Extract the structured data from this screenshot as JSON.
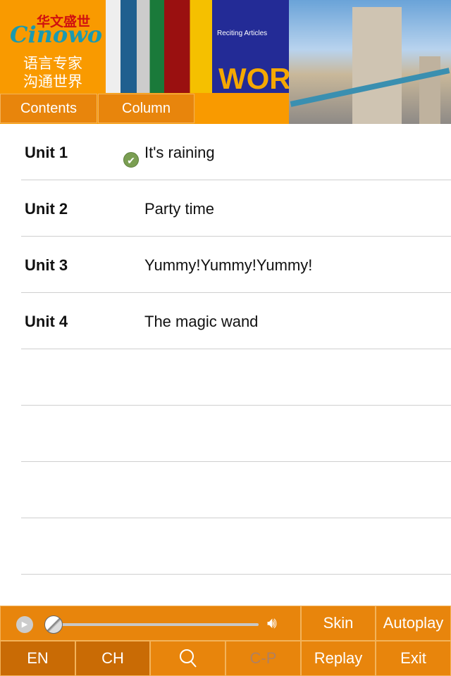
{
  "header": {
    "logo_cn": "华文盛世",
    "logo_en": "Cinowo",
    "slogan_line1": "语言专家",
    "slogan_line2": "沟通世界",
    "book_title": "Reciting Articles",
    "book_word": "WORD"
  },
  "tabs": [
    {
      "label": "Contents"
    },
    {
      "label": "Column"
    }
  ],
  "units": [
    {
      "unit": "Unit 1",
      "title": "It's raining",
      "completed": true
    },
    {
      "unit": "Unit 2",
      "title": "Party time",
      "completed": false
    },
    {
      "unit": "Unit 3",
      "title": "Yummy!Yummy!Yummy!",
      "completed": false
    },
    {
      "unit": "Unit 4",
      "title": "The magic wand",
      "completed": false
    }
  ],
  "player": {
    "progress": 0,
    "play_icon": "play-icon",
    "volume_icon": "speaker-icon"
  },
  "buttons": {
    "skin": "Skin",
    "autoplay": "Autoplay",
    "en": "EN",
    "ch": "CH",
    "search_icon": "search-icon",
    "cp": "C-P",
    "replay": "Replay",
    "exit": "Exit"
  },
  "colors": {
    "accent": "#E8850C",
    "header_orange": "#F99A00",
    "selected": "#C96B05"
  }
}
